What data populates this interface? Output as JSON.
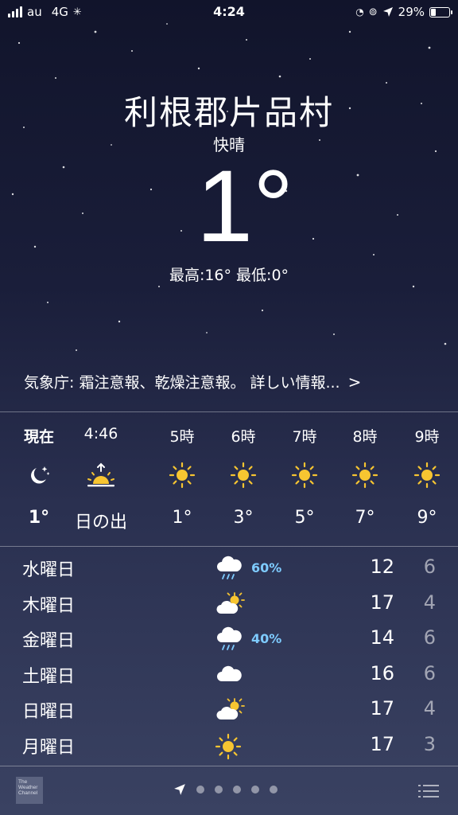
{
  "status_bar": {
    "carrier": "au",
    "network": "4G",
    "time": "4:24",
    "battery": "29%",
    "battery_level": 0.29
  },
  "location": {
    "city": "利根郡片品村",
    "condition": "快晴",
    "temperature": "1°",
    "hi_lo": "最高:16° 最低:0°"
  },
  "alert": {
    "text": "気象庁: 霜注意報、乾燥注意報。 詳しい情報...",
    "chevron": ">"
  },
  "hourly": [
    {
      "label": "現在",
      "icon": "moon-stars-icon",
      "value": "1°",
      "bold": true
    },
    {
      "label": "4:46",
      "icon": "sunrise-icon",
      "value": "日の出",
      "bold": false
    },
    {
      "label": "5時",
      "icon": "sun-icon",
      "value": "1°",
      "bold": false
    },
    {
      "label": "6時",
      "icon": "sun-icon",
      "value": "3°",
      "bold": false
    },
    {
      "label": "7時",
      "icon": "sun-icon",
      "value": "5°",
      "bold": false
    },
    {
      "label": "8時",
      "icon": "sun-icon",
      "value": "7°",
      "bold": false
    },
    {
      "label": "9時",
      "icon": "sun-icon",
      "value": "9°",
      "bold": false
    }
  ],
  "daily": [
    {
      "day": "水曜日",
      "icon": "rain-cloud-icon",
      "precip": "60%",
      "high": "12",
      "low": "6"
    },
    {
      "day": "木曜日",
      "icon": "partly-sunny-icon",
      "precip": "",
      "high": "17",
      "low": "4"
    },
    {
      "day": "金曜日",
      "icon": "rain-cloud-icon",
      "precip": "40%",
      "high": "14",
      "low": "6"
    },
    {
      "day": "土曜日",
      "icon": "cloud-icon",
      "precip": "",
      "high": "16",
      "low": "6"
    },
    {
      "day": "日曜日",
      "icon": "partly-sunny-icon",
      "precip": "",
      "high": "17",
      "low": "4"
    },
    {
      "day": "月曜日",
      "icon": "sun-icon",
      "precip": "",
      "high": "17",
      "low": "3"
    }
  ],
  "footer": {
    "logo_text": "The Weather Channel",
    "page_count": 5,
    "current_page": 0
  },
  "colors": {
    "sun": "#f7c531",
    "precip": "#7ecbff",
    "background_top": "#11142b",
    "background_bottom": "#3a4262"
  }
}
